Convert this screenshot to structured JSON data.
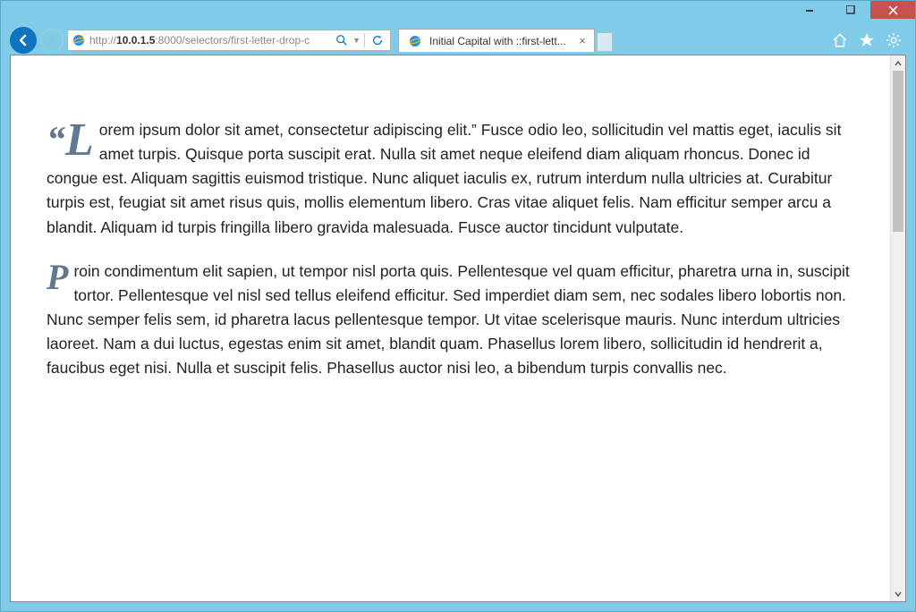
{
  "window": {
    "controls": {
      "minimize": "—",
      "maximize": "☐",
      "close": "✕"
    }
  },
  "toolbar": {
    "url_prefix": "http://",
    "url_host": "10.0.1.5",
    "url_rest": ":8000/selectors/first-letter-drop-c",
    "search_icon": "⌕",
    "refresh_icon": "↻"
  },
  "tab": {
    "title": "Initial Capital with ::first-lett...",
    "close": "×"
  },
  "page": {
    "p1_quote": "“",
    "p1_cap": "L",
    "p1_body": "orem ipsum dolor sit amet, consectetur adipiscing elit.” Fusce odio leo, sollicitudin vel mattis eget, iaculis sit amet turpis. Quisque porta suscipit erat. Nulla sit amet neque eleifend diam aliquam rhoncus. Donec id congue est. Aliquam sagittis euismod tristique. Nunc aliquet iaculis ex, rutrum interdum nulla ultricies at. Curabitur turpis est, feugiat sit amet risus quis, mollis elementum libero. Cras vitae aliquet felis. Nam efficitur semper arcu a blandit. Aliquam id turpis fringilla libero gravida malesuada. Fusce auctor tincidunt vulputate.",
    "p2_cap": "P",
    "p2_body": "roin condimentum elit sapien, ut tempor nisl porta quis. Pellentesque vel quam efficitur, pharetra urna in, suscipit tortor. Pellentesque vel nisl sed tellus eleifend efficitur. Sed imperdiet diam sem, nec sodales libero lobortis non. Nunc semper felis sem, id pharetra lacus pellentesque tempor. Ut vitae scelerisque mauris. Nunc interdum ultricies laoreet. Nam a dui luctus, egestas enim sit amet, blandit quam. Phasellus lorem libero, sollicitudin id hendrerit a, faucibus eget nisi. Nulla et suscipit felis. Phasellus auctor nisi leo, a bibendum turpis convallis nec."
  }
}
